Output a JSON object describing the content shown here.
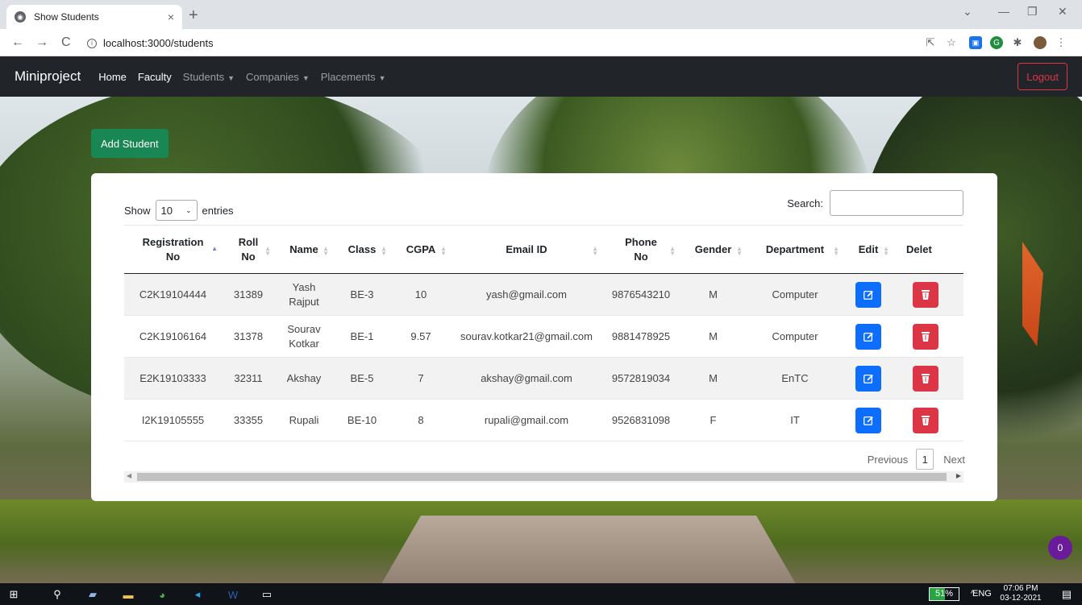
{
  "browser": {
    "tab_title": "Show Students",
    "tab_close": "×",
    "new_tab": "+",
    "url": "localhost:3000/students",
    "back": "←",
    "forward": "→",
    "reload": "C"
  },
  "navbar": {
    "brand": "Miniproject",
    "links": [
      "Home",
      "Faculty",
      "Students",
      "Companies",
      "Placements"
    ],
    "logout": "Logout"
  },
  "actions": {
    "add_student": "Add Student"
  },
  "table_controls": {
    "show_label": "Show",
    "entries_value": "10",
    "entries_label": "entries",
    "search_label": "Search:"
  },
  "table": {
    "columns": [
      "Registration No",
      "Roll No",
      "Name",
      "Class",
      "CGPA",
      "Email ID",
      "Phone No",
      "Gender",
      "Department",
      "Edit",
      "Delet"
    ],
    "rows": [
      [
        "C2K19104444",
        "31389",
        "Yash Rajput",
        "BE-3",
        "10",
        "yash@gmail.com",
        "9876543210",
        "M",
        "Computer"
      ],
      [
        "C2K19106164",
        "31378",
        "Sourav Kotkar",
        "BE-1",
        "9.57",
        "sourav.kotkar21@gmail.com",
        "9881478925",
        "M",
        "Computer"
      ],
      [
        "E2K19103333",
        "32311",
        "Akshay",
        "BE-5",
        "7",
        "akshay@gmail.com",
        "9572819034",
        "M",
        "EnTC"
      ],
      [
        "I2K19105555",
        "33355",
        "Rupali",
        "BE-10",
        "8",
        "rupali@gmail.com",
        "9526831098",
        "F",
        "IT"
      ]
    ]
  },
  "pagination": {
    "previous": "Previous",
    "page": "1",
    "next": "Next"
  },
  "floating_badge": "0",
  "taskbar": {
    "battery": "51%",
    "language": "ENG",
    "time": "07:06 PM",
    "date": "03-12-2021"
  },
  "colors": {
    "primary": "#0d6efd",
    "danger": "#dc3545",
    "success": "#198754",
    "navbar": "#212529"
  }
}
